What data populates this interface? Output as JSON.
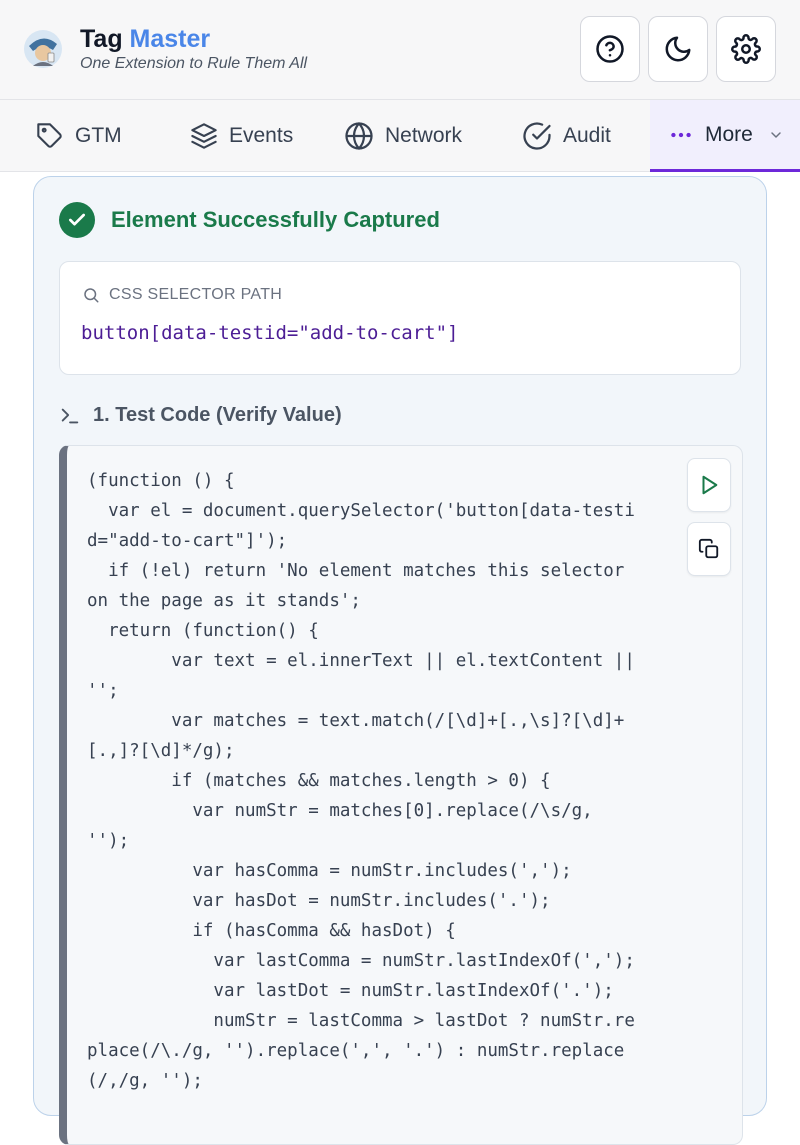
{
  "header": {
    "title_part1": "Tag",
    "title_part2": "Master",
    "subtitle": "One Extension to Rule Them All",
    "buttons": [
      "help-icon",
      "moon-icon",
      "gear-icon"
    ]
  },
  "tabs": [
    {
      "label": "GTM",
      "icon": "tag-icon"
    },
    {
      "label": "Events",
      "icon": "layers-icon"
    },
    {
      "label": "Network",
      "icon": "globe-icon"
    },
    {
      "label": "Audit",
      "icon": "check-circle-icon"
    },
    {
      "label": "More",
      "icon": "more-dots-icon",
      "active": true
    }
  ],
  "capture": {
    "status": "Element Successfully Captured",
    "selector_label": "CSS SELECTOR PATH",
    "selector_value": "button[data-testid=\"add-to-cart\"]",
    "section_title": "1. Test Code (Verify Value)",
    "code_lines": [
      "(function () {",
      "  var el = document.querySelector('button[data-testi",
      "d=\"add-to-cart\"]');",
      "  if (!el) return 'No element matches this selector",
      "on the page as it stands';",
      "  return (function() {",
      "        var text = el.innerText || el.textContent ||",
      "'';",
      "        var matches = text.match(/[\\d]+[.,\\s]?[\\d]+",
      "[.,]?[\\d]*/g);",
      "        if (matches && matches.length > 0) {",
      "          var numStr = matches[0].replace(/\\s/g,",
      "'');",
      "          var hasComma = numStr.includes(',');",
      "          var hasDot = numStr.includes('.');",
      "          if (hasComma && hasDot) {",
      "            var lastComma = numStr.lastIndexOf(',');",
      "            var lastDot = numStr.lastIndexOf('.');",
      "            numStr = lastComma > lastDot ? numStr.re",
      "place(/\\./g, '').replace(',', '.') : numStr.replace",
      "(/,/g, '');"
    ]
  },
  "colors": {
    "accent": "#4a86e8",
    "success": "#1a7a4a",
    "active_tab": "#6d28d9",
    "selector_text": "#4c1d95"
  }
}
